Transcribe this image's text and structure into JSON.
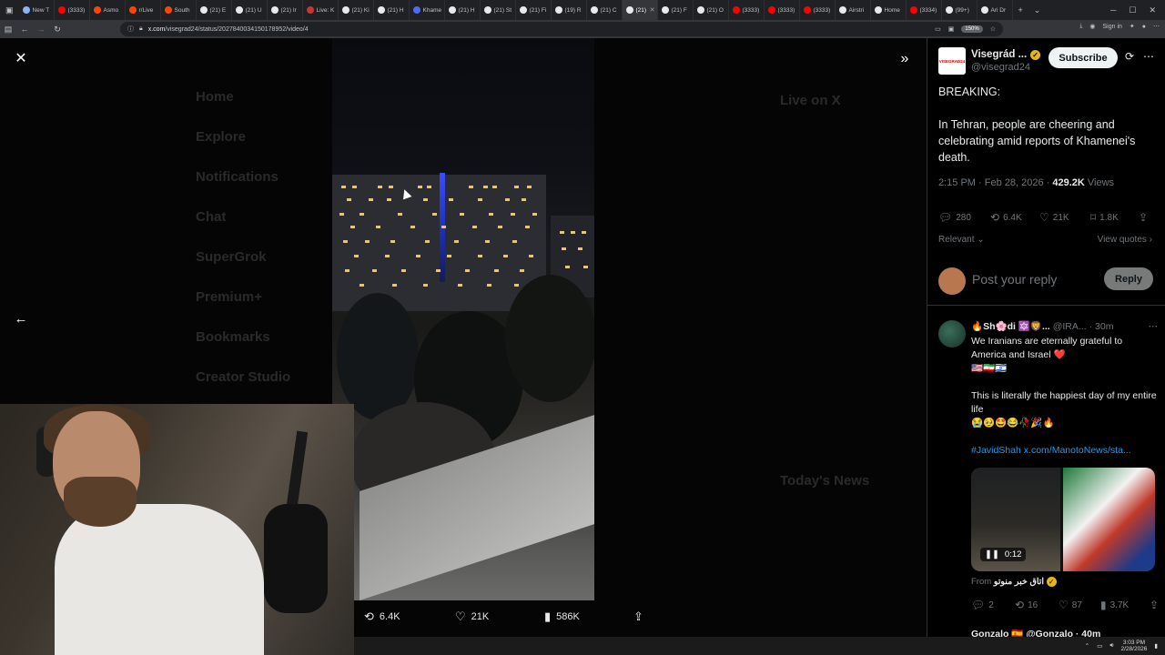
{
  "browser": {
    "tabs": [
      {
        "label": "New T",
        "color": "#8ab4f8"
      },
      {
        "label": "(3333)",
        "color": "#ff0000"
      },
      {
        "label": "Asmo",
        "color": "#ff4500"
      },
      {
        "label": "r/Live",
        "color": "#ff4500"
      },
      {
        "label": "South",
        "color": "#ff4500"
      },
      {
        "label": "(21) E",
        "color": "#e7e9ea"
      },
      {
        "label": "(21) U",
        "color": "#e7e9ea"
      },
      {
        "label": "(21) Ir",
        "color": "#e7e9ea"
      },
      {
        "label": "Live: K",
        "color": "#cc3333"
      },
      {
        "label": "(21) Ki",
        "color": "#e7e9ea"
      },
      {
        "label": "(21) H",
        "color": "#e7e9ea"
      },
      {
        "label": "Khame",
        "color": "#4a6cf7"
      },
      {
        "label": "(21) H",
        "color": "#e7e9ea"
      },
      {
        "label": "(21) St",
        "color": "#e7e9ea"
      },
      {
        "label": "(21) Fi",
        "color": "#e7e9ea"
      },
      {
        "label": "(19) R",
        "color": "#e7e9ea"
      },
      {
        "label": "(21) C",
        "color": "#e7e9ea"
      },
      {
        "label": "(21)",
        "color": "#e7e9ea"
      },
      {
        "label": "(21) F",
        "color": "#e7e9ea"
      },
      {
        "label": "(21) O",
        "color": "#e7e9ea"
      },
      {
        "label": "(3333)",
        "color": "#ff0000"
      },
      {
        "label": "(3333)",
        "color": "#ff0000"
      },
      {
        "label": "(3333)",
        "color": "#ff0000"
      },
      {
        "label": "Airstri",
        "color": "#e7e9ea"
      },
      {
        "label": "Home",
        "color": "#e7e9ea"
      },
      {
        "label": "(3334)",
        "color": "#ff0000"
      },
      {
        "label": "(99+)",
        "color": "#e7e9ea"
      },
      {
        "label": "Ari Dr",
        "color": "#e7e9ea"
      }
    ],
    "new_tab_glyph": "+",
    "url_host": "x.com",
    "url_path": "/visegrad24/status/2027840034150178952/video/4",
    "zoom": "150%",
    "sign_in": "Sign in"
  },
  "viewer": {
    "background_nav": [
      "Home",
      "Explore",
      "Notifications",
      "Chat",
      "SuperGrok",
      "Premium+",
      "Bookmarks",
      "Creator Studio"
    ],
    "background_header": "Live on X",
    "background_news": "Today's News",
    "stats": {
      "retweets": "6.4K",
      "likes": "21K",
      "views": "586K"
    }
  },
  "post": {
    "author_name": "Visegrád ...",
    "author_handle": "@visegrad24",
    "logo_text": "VISEGRAD24",
    "subscribe_label": "Subscribe",
    "text_line1": "BREAKING:",
    "text_body": "In Tehran, people are cheering and celebrating amid reports of Khamenei's death.",
    "time": "2:15 PM · Feb 28, 2026 · ",
    "views_count": "429.2K",
    "views_label": " Views",
    "replies": "280",
    "reposts": "6.4K",
    "likes": "21K",
    "bookmarks": "1.8K",
    "sort_label": "Relevant",
    "view_quotes": "View quotes",
    "reply_placeholder": "Post your reply",
    "reply_button": "Reply"
  },
  "reply": {
    "name": "🔥Sh🌸di 🔯🦁...",
    "handle": "@IRA...",
    "time": "· 30m",
    "line1": "We Iranians are eternally grateful to America and Israel ❤️",
    "flags": "🇺🇸🇮🇷🇮🇱",
    "line2": "This is literally the happiest day of my entire life",
    "emojis": "😭🥹🤩😂🥀🎉🔥",
    "hashtag": "#JavidShah",
    "link": "x.com/ManotoNews/sta...",
    "media_time": "0:12",
    "from_label": "From ",
    "from_source": "اتاق خبر منوتو",
    "replies": "2",
    "reposts": "16",
    "likes": "87",
    "views": "3.7K",
    "next_name": "Gonzalo 🇪🇸 @Gonzalo · 40m"
  },
  "taskbar": {
    "time": "3:03 PM",
    "date": "2/28/2026"
  }
}
